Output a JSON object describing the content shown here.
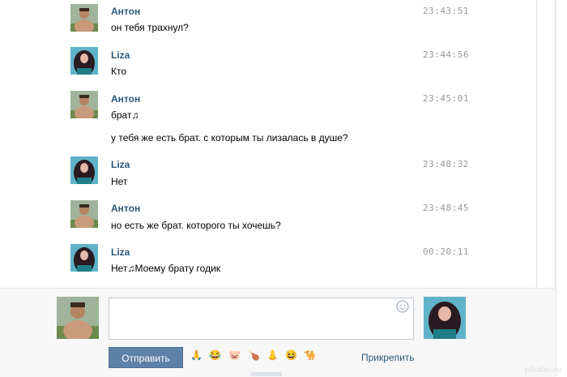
{
  "messages": [
    {
      "author": "Антон",
      "time": "23:43:51",
      "lines": [
        "он тебя трахнул?"
      ],
      "avatar": "anton"
    },
    {
      "author": "Liza",
      "time": "23:44:56",
      "lines": [
        "Кто"
      ],
      "avatar": "liza"
    },
    {
      "author": "Антон",
      "time": "23:45:01",
      "lines": [
        "брат♫",
        "у тебя же есть брат. с которым ты лизалась в душе?"
      ],
      "avatar": "anton"
    },
    {
      "author": "Liza",
      "time": "23:48:32",
      "lines": [
        "Нет"
      ],
      "avatar": "liza"
    },
    {
      "author": "Антон",
      "time": "23:48:45",
      "lines": [
        "но есть же брат. которого ты хочешь?"
      ],
      "avatar": "anton"
    },
    {
      "author": "Liza",
      "time": "00:20:11",
      "lines": [
        "Нет♫Моему брату годик"
      ],
      "avatar": "liza"
    }
  ],
  "composer": {
    "send_label": "Отправить",
    "attach_label": "Прикрепить",
    "emojis": [
      "🙏",
      "😂",
      "🐷",
      "🍗",
      "👃",
      "😆",
      "🐪"
    ],
    "input_value": ""
  },
  "watermark": "pikabu.ru",
  "colors": {
    "author": "#2b587a",
    "send_button": "#5e81a8",
    "time": "#999999"
  },
  "icons": {
    "smile": "smile-icon"
  }
}
